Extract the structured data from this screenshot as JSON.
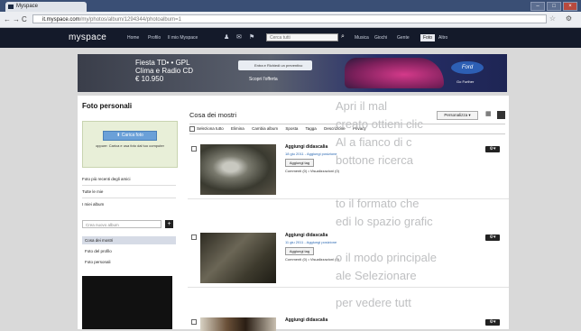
{
  "browser": {
    "tab_title": "Myspace",
    "url_domain": "it.myspace.com",
    "url_path": "/my/photos/album/1294344/photoalbum=1",
    "back_icon": "back-arrow",
    "forward_icon": "forward-arrow",
    "reload_icon": "reload",
    "bookmark_icon": "star",
    "settings_icon": "wrench"
  },
  "topnav": {
    "logo": "myspace",
    "links": [
      "Home",
      "Profilo",
      "Il mio Myspace",
      "Musica",
      "Giochi",
      "Gente",
      "Foto",
      "Altro"
    ],
    "search_placeholder": "Cerca tutti",
    "active_link": "Foto"
  },
  "ad": {
    "headline_1": "Fiesta TD• • GPL",
    "headline_2": "Clima e Radio CD",
    "headline_3": "€ 10.950",
    "phone_placeholder": "Entra e Richiedi un preventivo",
    "cta": "Scopri l'offerta",
    "brand": "Ford",
    "tagline": "Go Further"
  },
  "sidebar": {
    "title": "Foto personali",
    "upload_button": "Carica foto",
    "upload_note": "oppure: Carica e usa foto dal tuo computer",
    "links": [
      "Foto più recenti degli amici",
      "Tutte le mie",
      "I miei album"
    ],
    "new_album_placeholder": "Crea nuovo album",
    "albums": [
      "Cosa dei mostri",
      "Foto del profilo",
      "Foto personali"
    ],
    "active_album": "Cosa dei mostri"
  },
  "main": {
    "album_title": "Cosa dei mostri",
    "personalize": "Personalizza ▾",
    "toolbar": [
      "Seleziona tutto",
      "Elimina",
      "Cambia album",
      "Sposta",
      "Tagga",
      "Descrizione",
      "Privacy"
    ],
    "photos": [
      {
        "caption": "Aggiungi didascalia",
        "date": "18 giu 2011 - Aggiungi posizione",
        "tag_button": "Aggiungi tag",
        "comments": "Commenti (0) • Visualizzazioni (0)"
      },
      {
        "caption": "Aggiungi didascalia",
        "date": "11 giu 2011 - Aggiungi posizione",
        "tag_button": "Aggiungi tag",
        "comments": "Commenti (0) • Visualizzazioni (0)"
      },
      {
        "caption": "Aggiungi didascalia"
      }
    ]
  },
  "overlay_text": [
    "Apri il mal",
    "creato ottieni clic",
    "Al a fianco di c",
    "bottone ricerca",
    "to il formato che",
    "edi lo spazio grafic",
    "o il modo principale",
    "ale Selezionare",
    "per vedere tutt"
  ]
}
